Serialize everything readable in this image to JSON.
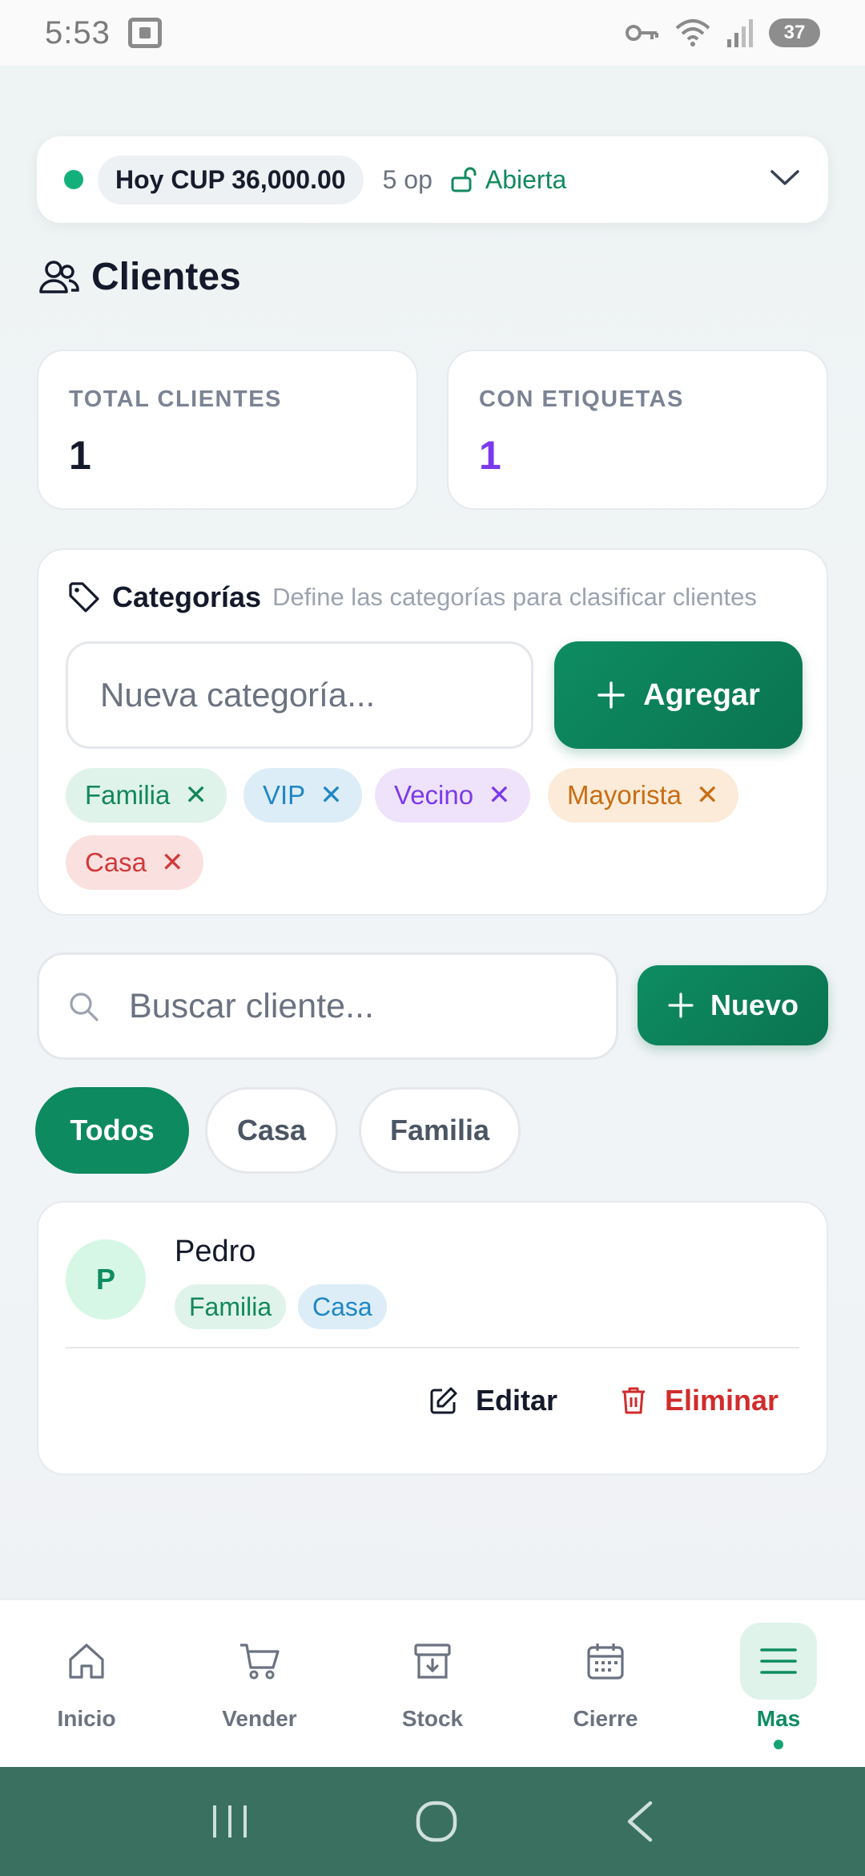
{
  "status_bar": {
    "time": "5:53",
    "battery": "37"
  },
  "session": {
    "today_label": "Hoy CUP 36,000.00",
    "ops": "5 op",
    "state": "Abierta"
  },
  "page": {
    "title": "Clientes"
  },
  "stats": {
    "total_label": "TOTAL CLIENTES",
    "total_value": "1",
    "tagged_label": "CON ETIQUETAS",
    "tagged_value": "1"
  },
  "categories": {
    "title": "Categorías",
    "subtitle": "Define las categorías para clasificar clientes",
    "input_placeholder": "Nueva categoría...",
    "add_label": "Agregar",
    "remove_glyph": "✕",
    "chips": [
      {
        "label": "Familia",
        "bg": "#dff3ea",
        "fg": "#13875c"
      },
      {
        "label": "VIP",
        "bg": "#dcedf8",
        "fg": "#1f87c2"
      },
      {
        "label": "Vecino",
        "bg": "#efe3fb",
        "fg": "#7c3aed"
      },
      {
        "label": "Mayorista",
        "bg": "#fcebd9",
        "fg": "#c86e13"
      },
      {
        "label": "Casa",
        "bg": "#fbe0e0",
        "fg": "#d13a3a"
      }
    ]
  },
  "search": {
    "placeholder": "Buscar cliente...",
    "new_label": "Nuevo"
  },
  "filters": [
    "Todos",
    "Casa",
    "Familia"
  ],
  "client": {
    "initial": "P",
    "name": "Pedro",
    "tags": [
      {
        "label": "Familia",
        "bg": "#dff3ea",
        "fg": "#13875c"
      },
      {
        "label": "Casa",
        "bg": "#dcedf8",
        "fg": "#1f87c2"
      }
    ],
    "edit_label": "Editar",
    "delete_label": "Eliminar"
  },
  "nav": {
    "items": [
      "Inicio",
      "Vender",
      "Stock",
      "Cierre",
      "Mas"
    ],
    "active": "Mas"
  },
  "colors": {
    "accent": "#0e8c62",
    "danger": "#d12c2c",
    "purple": "#7c3aed"
  }
}
